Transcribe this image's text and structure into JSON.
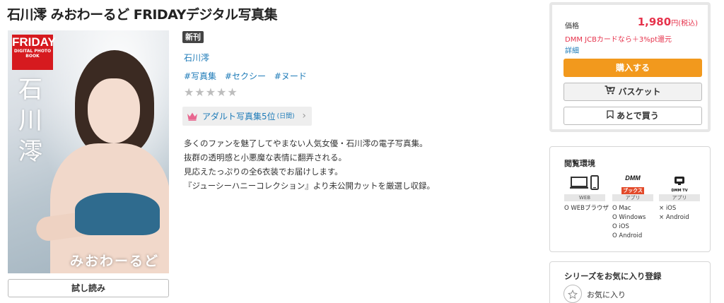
{
  "page": {
    "title": "石川澪 みおわーるど FRIDAYデジタル写真集"
  },
  "cover": {
    "logo_main": "FRIDAY",
    "logo_sub": "DIGITAL PHOTO BOOK",
    "vertical_name": "石川澪",
    "subtitle": "みおわーるど"
  },
  "trial_button": "試し読み",
  "info": {
    "badge": "新刊",
    "author": "石川澪",
    "tags": [
      "#写真集",
      "#セクシー",
      "#ヌード"
    ],
    "rating_stars": 5,
    "rating_filled": 0,
    "ranking": {
      "text": "アダルト写真集5位",
      "period": "(日間)"
    },
    "description": [
      "多くのファンを魅了してやまない人気女優・石川澪の電子写真集。",
      "抜群の透明感と小悪魔な表情に翻弄される。",
      "見応えたっぷりの全6衣装でお届けします。",
      "『ジューシーハニーコレクション』より未公開カットを厳選し収録。"
    ]
  },
  "purchase": {
    "price_label": "価格",
    "price": "1,980",
    "price_unit": "円(税込)",
    "campaign": "DMM JCBカードなら＋3%pt還元",
    "detail_link": "詳細",
    "buy_label": "購入する",
    "basket_label": "バスケット",
    "later_label": "あとで買う",
    "accent_color": "#f2991d",
    "price_color": "#e6334c"
  },
  "environment": {
    "title": "閲覧環境",
    "columns": [
      {
        "icon": "pc-phone-icon",
        "tag": "WEB",
        "items": [
          "O WEBブラウザ"
        ]
      },
      {
        "icon": "dmm-books-icon",
        "tag": "アプリ",
        "logo_top": "DMM",
        "logo_bottom": "ブックス",
        "items": [
          "O Mac",
          "O Windows",
          "O iOS",
          "O Android"
        ]
      },
      {
        "icon": "dmm-tv-icon",
        "tag": "アプリ",
        "logo_bottom": "DMM TV",
        "items": [
          "× iOS",
          "× Android"
        ]
      }
    ]
  },
  "series": {
    "title": "シリーズをお気に入り登録",
    "favorite_label": "お気に入り"
  }
}
